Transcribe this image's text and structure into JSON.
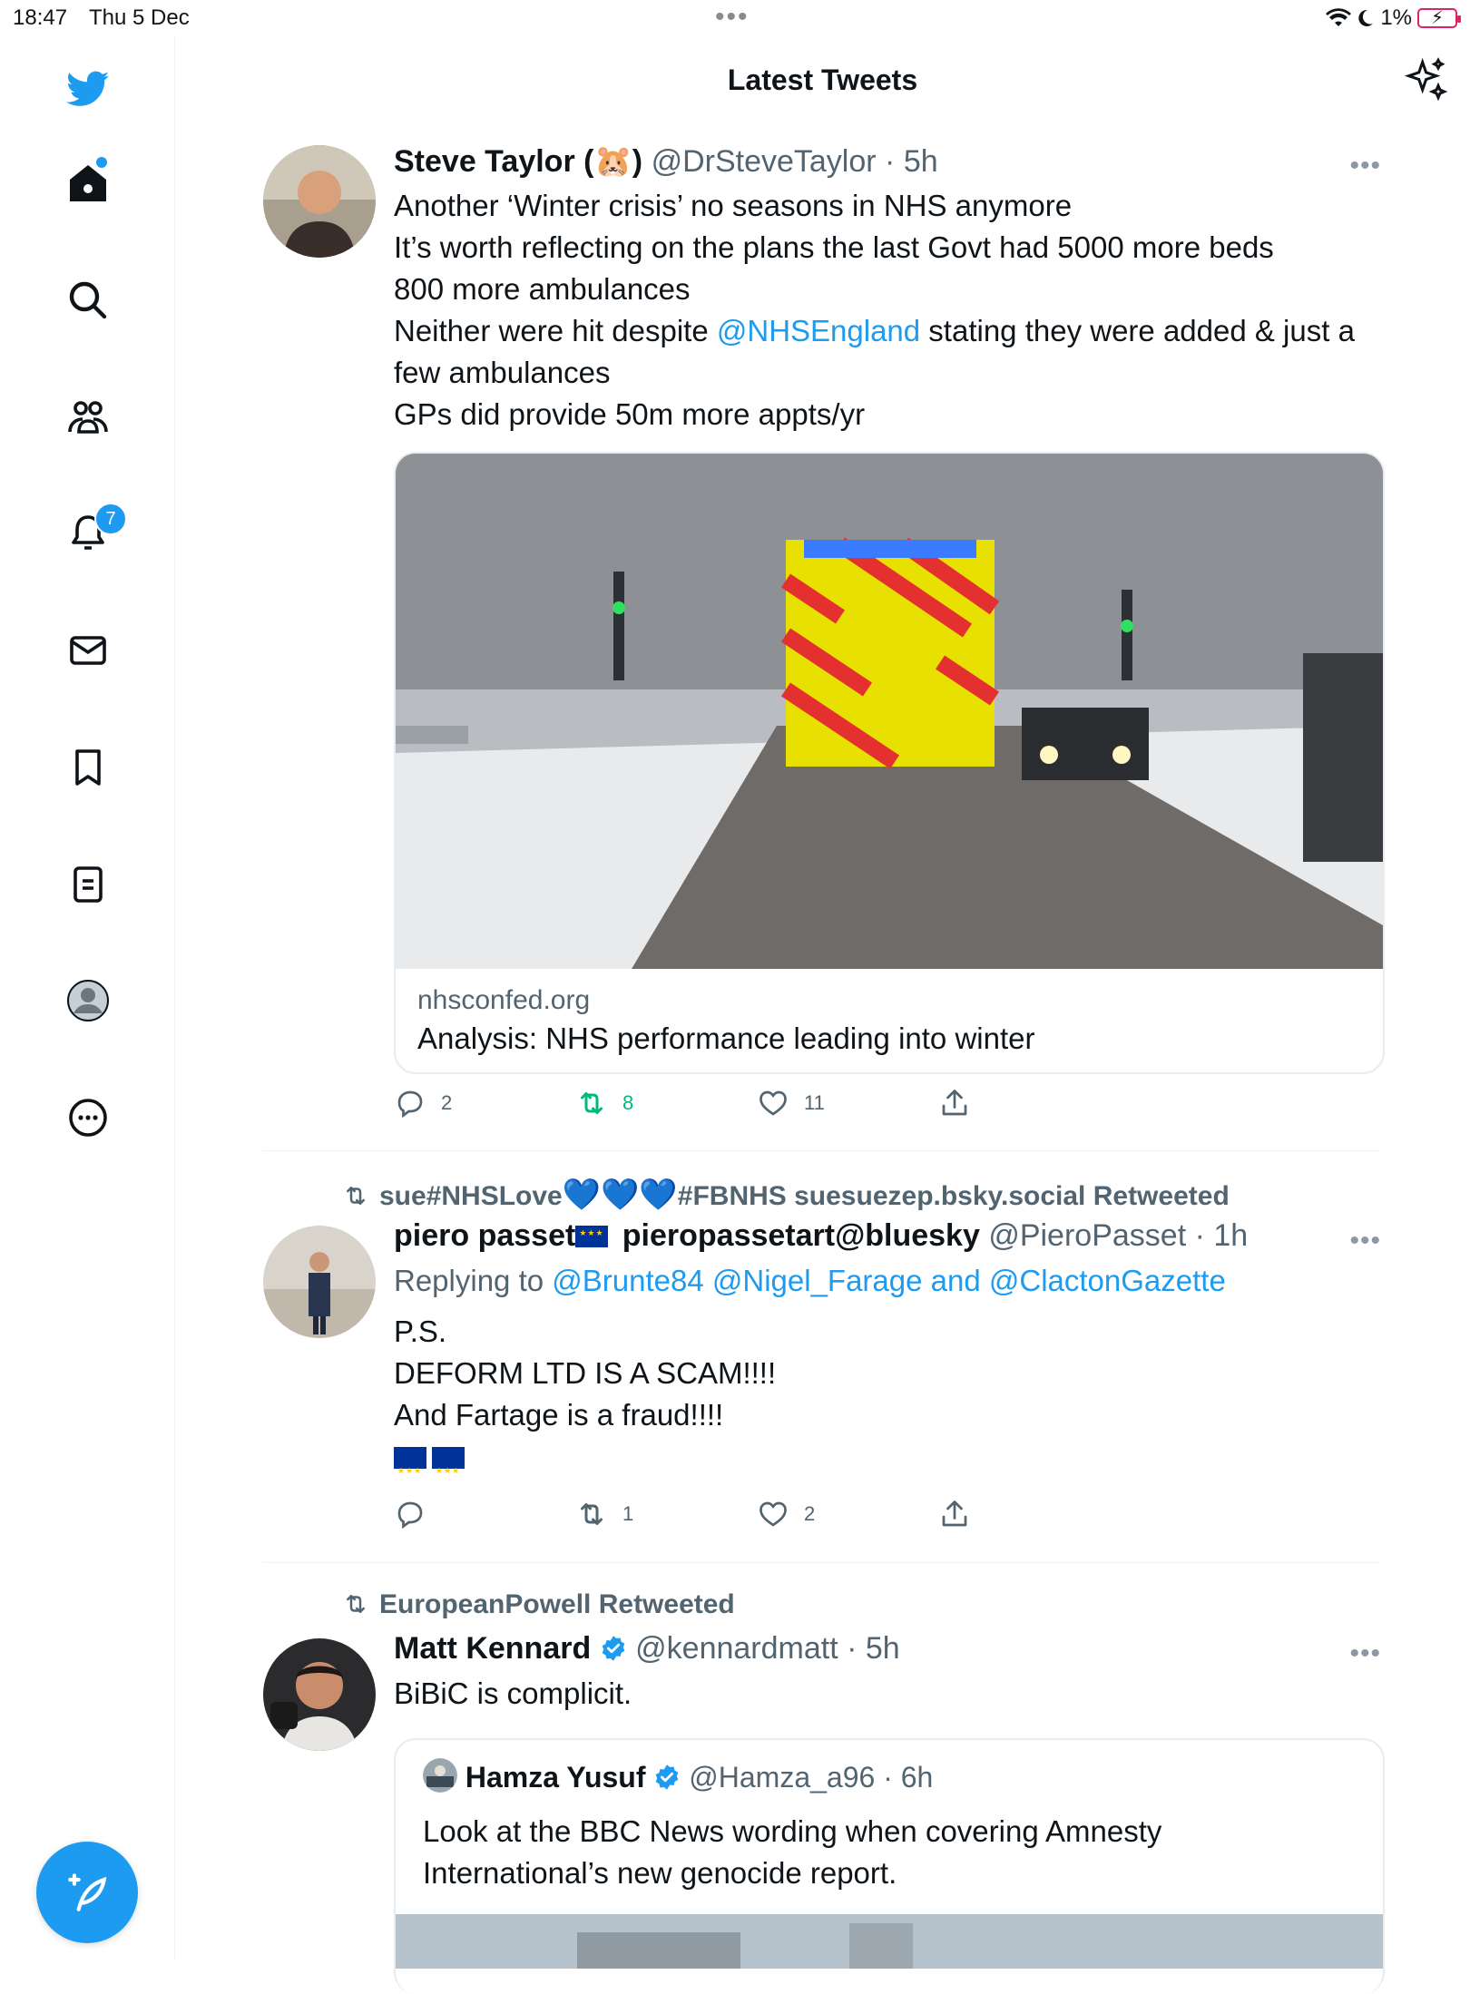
{
  "status_bar": {
    "time": "18:47",
    "date": "Thu 5 Dec",
    "battery": "1%"
  },
  "header": {
    "title": "Latest Tweets"
  },
  "sidebar": {
    "notifications_count": "7"
  },
  "tweets": [
    {
      "name": "Steve Taylor (🐹)",
      "handle": "@DrSteveTaylor",
      "time": "· 5h",
      "lines": [
        "Another ‘Winter crisis’ no seasons in NHS anymore",
        "It’s worth reflecting on the plans the last Govt had 5000 more beds",
        "800 more ambulances",
        "Neither were hit despite ",
        "@NHSEngland",
        " stating they were added & just a",
        "few ambulances",
        "GPs did provide 50m more appts/yr"
      ],
      "card": {
        "domain": "nhsconfed.org",
        "title": "Analysis: NHS performance leading into winter"
      },
      "replies": "2",
      "retweets": "8",
      "likes": "11"
    },
    {
      "retweeted_by_a": "sue#NHSLove",
      "retweeted_by_b": "#FBNHS suesuezep.bsky.social Retweeted",
      "name": "piero passet",
      "name2": "pieropassetart@bluesky",
      "handle": "@PieroPasset",
      "time": "· 1h",
      "replying_prefix": "Replying to ",
      "replying_mentions": "@Brunte84 @Nigel_Farage and @ClactonGazette",
      "lines": [
        "P.S.",
        "DEFORM LTD IS A SCAM!!!!",
        "And Fartage is a fraud!!!!"
      ],
      "replies": "",
      "retweets": "1",
      "likes": "2"
    },
    {
      "retweeted_by": "EuropeanPowell Retweeted",
      "name": "Matt Kennard",
      "handle": "@kennardmatt",
      "time": "· 5h",
      "text": "BiBiC is complicit.",
      "quote": {
        "name": "Hamza Yusuf",
        "handle": "@Hamza_a96",
        "time": "· 6h",
        "line1": "Look at the BBC News wording when covering Amnesty",
        "line2": "International’s new genocide report."
      }
    }
  ],
  "colors": {
    "accent": "#1d9bf0",
    "retweet": "#00ba7c",
    "muted": "#536471"
  }
}
